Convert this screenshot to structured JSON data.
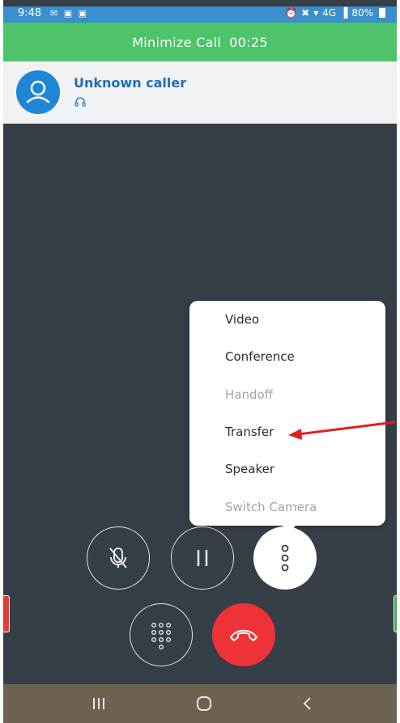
{
  "status_bar": {
    "time": "9:48",
    "left_icons": "✉ ▣ ▣",
    "signal_text": "4G",
    "battery": "80%"
  },
  "minimize_bar": {
    "label": "Minimize Call",
    "timer": "00:25"
  },
  "caller": {
    "name": "Unknown caller"
  },
  "menu": {
    "items": [
      {
        "label": "Video",
        "enabled": true
      },
      {
        "label": "Conference",
        "enabled": true
      },
      {
        "label": "Handoff",
        "enabled": false
      },
      {
        "label": "Transfer",
        "enabled": true
      },
      {
        "label": "Speaker",
        "enabled": true
      },
      {
        "label": "Switch Camera",
        "enabled": false
      }
    ]
  },
  "colors": {
    "status_bar": "#3a8fcd",
    "minimize_bar": "#4ec36b",
    "caller_name": "#1f6fb5",
    "avatar": "#1f86d7",
    "call_background": "#363e48",
    "end_call": "#ee3338",
    "annotation_arrow": "#e02020",
    "nav_bar": "#6d6150"
  },
  "icons": {
    "mute": "microphone-off-icon",
    "hold": "pause-icon",
    "more": "more-vertical-icon",
    "keypad": "dialpad-icon",
    "end_call": "phone-hangup-icon",
    "avatar": "user-icon",
    "headset": "headset-icon"
  }
}
